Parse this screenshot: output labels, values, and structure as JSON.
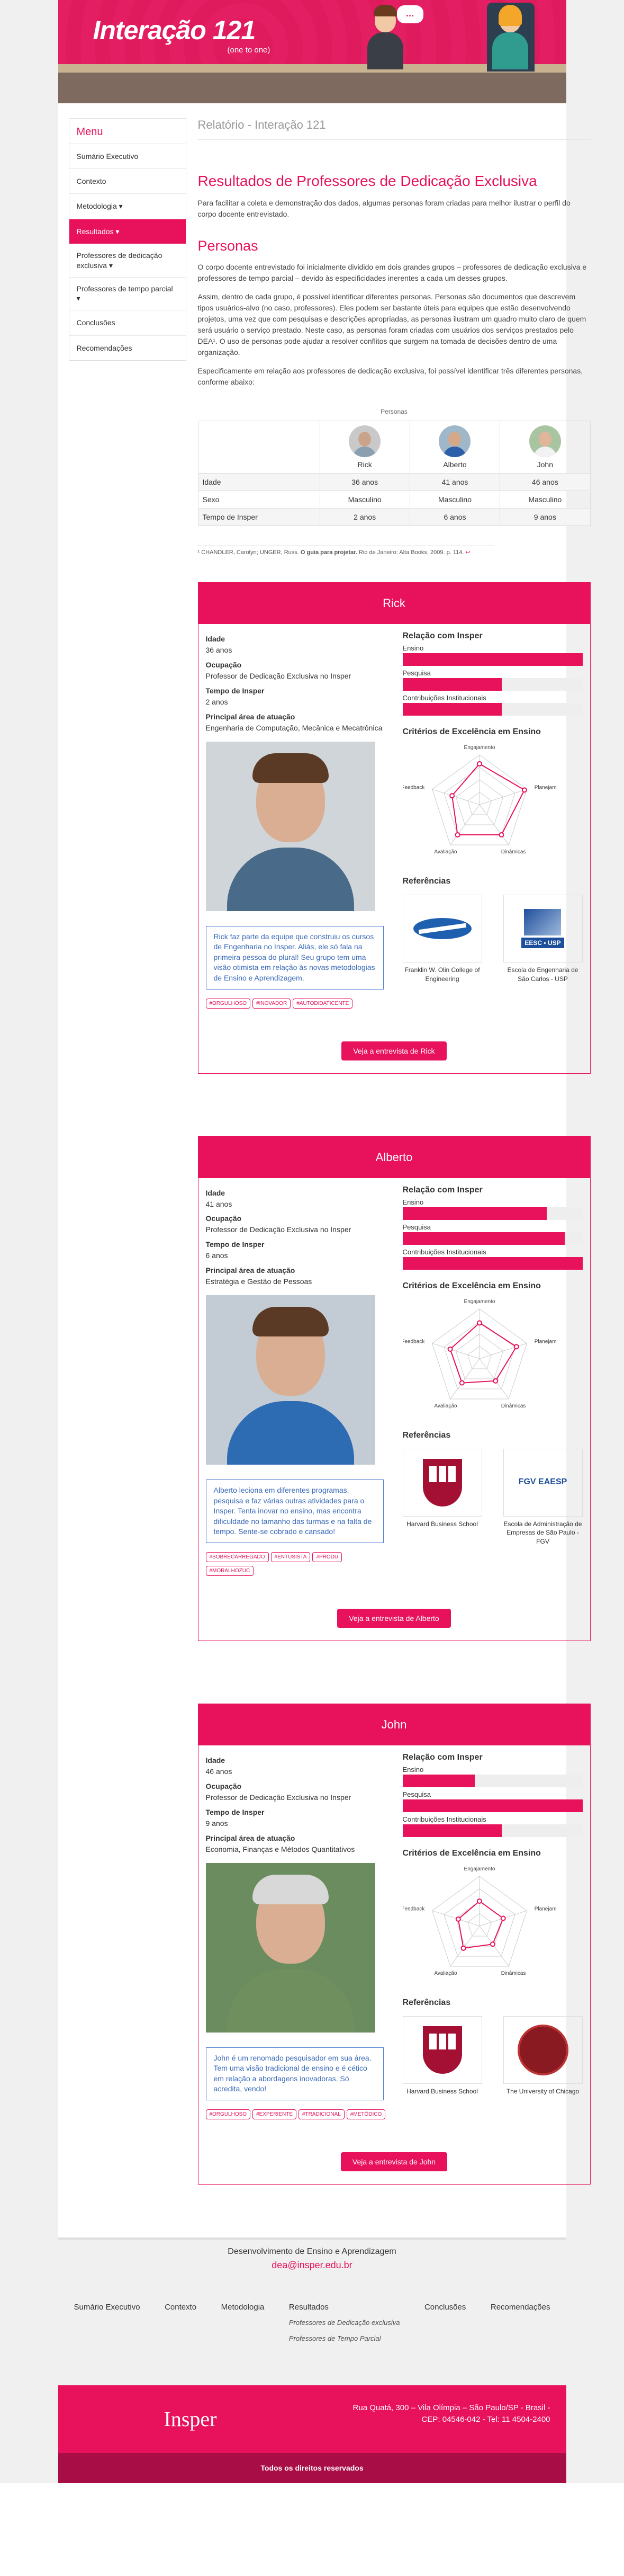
{
  "header": {
    "title": "Interação 121",
    "subtitle": "(one to one)",
    "bubble_text": "..."
  },
  "menu": {
    "title": "Menu",
    "items": [
      "Sumário Executivo",
      "Contexto",
      "Metodologia ▾",
      "Resultados ▾"
    ],
    "sub_items": [
      "Professores de dedicação exclusiva ▾",
      "Professores de tempo parcial ▾"
    ],
    "items_after": [
      "Conclusões",
      "Recomendações"
    ]
  },
  "breadcrumb": "Relatório - Interação 121",
  "page_title": "Resultados de Professores de Dedicação Exclusiva",
  "intro": "Para facilitar a coleta e demonstração dos dados, algumas personas foram criadas para melhor ilustrar o perfil do corpo docente entrevistado.",
  "personas_heading": "Personas",
  "personas_p1": "O corpo docente entrevistado foi inicialmente dividido em dois grandes grupos – professores de dedicação exclusiva e professores de tempo parcial – devido às especificidades inerentes a cada um desses grupos.",
  "personas_p2": "Assim, dentro de cada grupo, é possível identificar diferentes personas. Personas são documentos que descrevem tipos usuários-alvo (no caso, professores). Eles podem ser bastante úteis para equipes que estão desenvolvendo projetos, uma vez que com pesquisas e descrições apropriadas, as personas ilustram um quadro muito claro de quem será usuário o serviço prestado. Neste caso, as personas foram criadas com usuários dos serviços prestados pelo DEA¹. O uso de personas pode ajudar a resolver conflitos que surgem na tomada de decisões dentro de uma organização.",
  "personas_p3": "Especificamente em relação aos professores de dedicação exclusiva, foi possível identificar três diferentes personas, conforme abaixo:",
  "table": {
    "caption": "Personas",
    "names": [
      "Rick",
      "Alberto",
      "John"
    ],
    "rows": [
      {
        "label": "Idade",
        "values": [
          "36 anos",
          "41 anos",
          "46 anos"
        ]
      },
      {
        "label": "Sexo",
        "values": [
          "Masculino",
          "Masculino",
          "Masculino"
        ]
      },
      {
        "label": "Tempo de Insper",
        "values": [
          "2 anos",
          "6 anos",
          "9 anos"
        ]
      }
    ]
  },
  "footnote": {
    "pre": "¹ CHANDLER, Carolyn; UNGER, Russ. ",
    "bold": "O guia para projetar.",
    "post": " Rio de Janeiro: Alta Books, 2009. p. 114.",
    "mark": "↩"
  },
  "labels": {
    "idade": "Idade",
    "ocupacao": "Ocupação",
    "tempo": "Tempo de Insper",
    "area": "Principal área de atuação",
    "relacao": "Relação com Insper",
    "ensino": "Ensino",
    "pesquisa": "Pesquisa",
    "contrib": "Contribuições Institucionais",
    "criterios": "Critérios de Excelência em Ensino",
    "referencias": "Referências",
    "radar_axes": [
      "Engajamento",
      "Planejamento",
      "Dinâmicas",
      "Avaliação",
      "Feedback"
    ]
  },
  "personas": [
    {
      "name": "Rick",
      "idade": "36 anos",
      "ocupacao": "Professor de Dedicação Exclusiva no Insper",
      "tempo": "2 anos",
      "area": "Engenharia de Computação, Mecânica e Mecatrônica",
      "bars": [
        1.0,
        0.55,
        0.55
      ],
      "radar": [
        0.82,
        0.95,
        0.75,
        0.75,
        0.58
      ],
      "quote": "Rick faz parte da equipe que construiu os cursos de Engenharia no Insper. Aliás, ele só fala na primeira pessoa do plural! Seu grupo tem uma visão otimista em relação às novas metodologias de Ensino e Aprendizagem.",
      "tags": [
        "#ORGULHOSO",
        "#INOVADOR",
        "#AUTODIDATICENTE"
      ],
      "refs": [
        {
          "name": "Franklin W. Olin College of Engineering",
          "logo": "olin"
        },
        {
          "name": "Escola de Engenharia de São Carlos - USP",
          "logo": "eesc",
          "logo_text": "EESC • USP"
        }
      ],
      "button": "Veja a entrevista de Rick",
      "accent": "#4a6a8a"
    },
    {
      "name": "Alberto",
      "idade": "41 anos",
      "ocupacao": "Professor de Dedicação Exclusiva no Insper",
      "tempo": "6 anos",
      "area": "Estratégia e Gestão de Pessoas",
      "bars": [
        0.8,
        0.9,
        1.0
      ],
      "radar": [
        0.72,
        0.78,
        0.55,
        0.6,
        0.62
      ],
      "quote": "Alberto leciona em diferentes programas, pesquisa e faz várias outras atividades para o Insper. Tenta inovar no ensino, mas encontra dificuldade no tamanho das turmas e na falta de tempo. Sente-se cobrado e cansado!",
      "tags": [
        "#SOBRECARREGADO",
        "#ENTUSISTA",
        "#PRODU",
        "#MORALHOZUC"
      ],
      "refs": [
        {
          "name": "Harvard Business School",
          "logo": "harvard"
        },
        {
          "name": "Escola de Administração de Empresas de São Paulo - FGV",
          "logo": "fgv",
          "logo_text": "FGV EAESP"
        }
      ],
      "button": "Veja a entrevista de Alberto",
      "accent": "#2d6bb3"
    },
    {
      "name": "John",
      "idade": "46 anos",
      "ocupacao": "Professor de Dedicação Exclusiva no Insper",
      "tempo": "9 anos",
      "area": "Economia, Finanças e Métodos Quantitativos",
      "bars": [
        0.4,
        1.0,
        0.55
      ],
      "radar": [
        0.5,
        0.5,
        0.45,
        0.55,
        0.45
      ],
      "quote": "John é um renomado pesquisador em sua área. Tem uma visão tradicional de ensino e é cético em relação a abordagens inovadoras. Só acredita, vendo!",
      "tags": [
        "#ORGULHOSO",
        "#EXPERIENTE",
        "#TRADICIONAL",
        "#METÓDICO"
      ],
      "refs": [
        {
          "name": "Harvard Business School",
          "logo": "harvard"
        },
        {
          "name": "The University of Chicago",
          "logo": "chicago"
        }
      ],
      "button": "Veja a entrevista de John",
      "accent": "#6f8f5f"
    }
  ],
  "footer": {
    "dev": "Desenvolvimento de Ensino e Aprendizagem",
    "email": "dea@insper.edu.br",
    "nav": [
      "Sumário Executivo",
      "Contexto",
      "Metodologia",
      "Resultados",
      "Conclusões",
      "Recomendações"
    ],
    "nav_sub": [
      "Professores de Dedicação exclusiva",
      "Professores de Tempo Parcial"
    ],
    "logo": "Insper",
    "addr1": "Rua Quatá, 300 – Vila Olímpia – São Paulo/SP - Brasil -",
    "addr2": "CEP: 04546-042 - Tel: 11 4504-2400",
    "copy": "Todos os direitos reservados"
  }
}
